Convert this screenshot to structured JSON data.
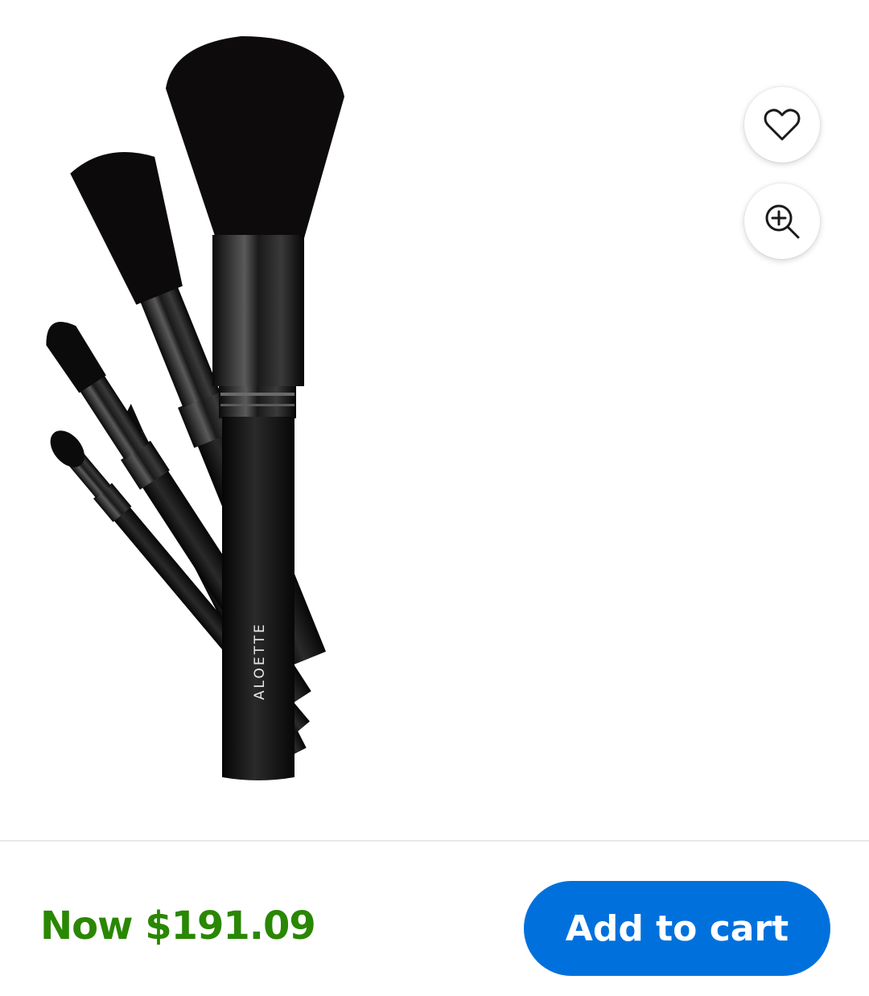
{
  "product": {
    "image_alt": "Makeup brush set",
    "brand_mark": "ALOETTE"
  },
  "actions": {
    "favorite_icon": "heart-outline-icon",
    "zoom_icon": "zoom-in-icon"
  },
  "purchase_bar": {
    "price_label": "Now $191.09",
    "add_to_cart_label": "Add to cart"
  },
  "colors": {
    "price_green": "#2a8703",
    "primary_blue": "#0071dc",
    "divider": "#e9e9eb"
  }
}
